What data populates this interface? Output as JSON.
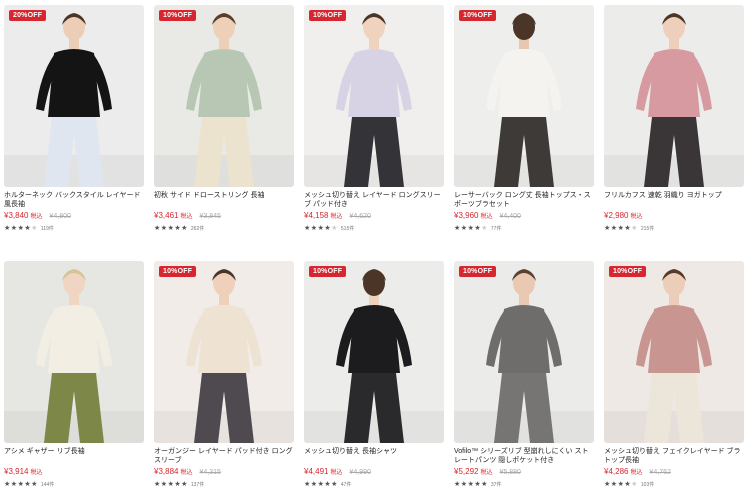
{
  "products": [
    {
      "badge": "20%OFF",
      "title": "ホルターネック バックスタイル レイヤード風長袖",
      "price": "¥3,840",
      "tax": "税込",
      "old": "¥4,800",
      "count": "119件",
      "stars": 4,
      "bg": "#ececec",
      "top": "#141414",
      "bottom": "#dfe6ef",
      "skin": "#eccdb6",
      "hair": "#4a3526",
      "back": false
    },
    {
      "badge": "10%OFF",
      "title": "初秋 サイド ドローストリング 長袖",
      "price": "¥3,461",
      "tax": "税込",
      "old": "¥3,845",
      "count": "262件",
      "stars": 5,
      "bg": "#e9e9e6",
      "top": "#b7c7b3",
      "bottom": "#ece3cf",
      "skin": "#eecfb8",
      "hair": "#5a3d28",
      "back": false
    },
    {
      "badge": "10%OFF",
      "title": "メッシュ切り替え レイヤード ロングスリーブ パッド付き",
      "price": "¥4,158",
      "tax": "税込",
      "old": "¥4,620",
      "count": "515件",
      "stars": 4,
      "bg": "#f0efed",
      "top": "#d8d3e4",
      "bottom": "#333338",
      "skin": "#efd3bf",
      "hair": "#4b3525",
      "back": false
    },
    {
      "badge": "10%OFF",
      "title": "レーサーバック ロング丈 長袖トップス・スポーツブラセット",
      "price": "¥3,960",
      "tax": "税込",
      "old": "¥4,400",
      "count": "77件",
      "stars": 4,
      "bg": "#eeeeec",
      "top": "#f4f3f0",
      "bottom": "#3e3a37",
      "skin": "#e8c7b0",
      "hair": "#4a3526",
      "back": true
    },
    {
      "badge": "",
      "title": "フリルカフス 速乾 羽織り ヨガトップ",
      "price": "¥2,980",
      "tax": "税込",
      "old": "",
      "count": "215件",
      "stars": 4,
      "bg": "#ececea",
      "top": "#d69aa0",
      "bottom": "#3a3536",
      "skin": "#eecfbb",
      "hair": "#4e3627",
      "back": false
    },
    {
      "badge": "",
      "title": "アシメ ギャザー リブ長袖",
      "price": "¥3,914",
      "tax": "税込",
      "old": "",
      "count": "144件",
      "stars": 5,
      "bg": "#e6e7e3",
      "top": "#f2eee4",
      "bottom": "#7c8748",
      "skin": "#f0d6c2",
      "hair": "#d8c396",
      "back": false
    },
    {
      "badge": "10%OFF",
      "title": "オーガンジー レイヤード パッド付き ロングスリーブ",
      "price": "¥3,884",
      "tax": "税込",
      "old": "¥4,315",
      "count": "137件",
      "stars": 5,
      "bg": "#f1ece8",
      "top": "#eee2d3",
      "bottom": "#4e4a4f",
      "skin": "#efd0bb",
      "hair": "#4b3626",
      "back": false
    },
    {
      "badge": "10%OFF",
      "title": "メッシュ切り替え 長袖シャツ",
      "price": "¥4,491",
      "tax": "税込",
      "old": "¥4,990",
      "count": "47件",
      "stars": 5,
      "bg": "#ececea",
      "top": "#1c1c1e",
      "bottom": "#2a2a2c",
      "skin": "#efd2be",
      "hair": "#4a3526",
      "back": true
    },
    {
      "badge": "10%OFF",
      "title": "Vofilo™ シリーズリブ 型崩れしにくい ストレートパンツ 隠しポケット付き",
      "price": "¥5,292",
      "tax": "税込",
      "old": "¥5,880",
      "count": "37件",
      "stars": 5,
      "bg": "#ebebe9",
      "top": "#6f6d6b",
      "bottom": "#777573",
      "skin": "#e9c9b1",
      "hair": "#5a4030",
      "back": false
    },
    {
      "badge": "10%OFF",
      "title": "メッシュ切り替え フェイクレイヤード ブラトップ長袖",
      "price": "¥4,286",
      "tax": "税込",
      "old": "¥4,762",
      "count": "103件",
      "stars": 4,
      "bg": "#efe9e5",
      "top": "#c89591",
      "bottom": "#ece6da",
      "skin": "#eccdb8",
      "hair": "#553a2a",
      "back": false
    }
  ],
  "icons": {
    "rating": "star-icon"
  },
  "colors": {
    "sale": "#d6262f"
  }
}
